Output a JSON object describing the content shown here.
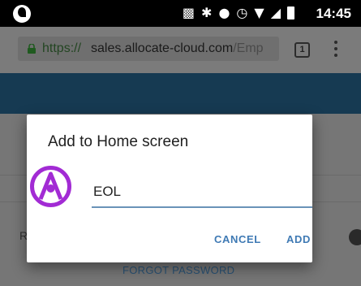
{
  "status_bar": {
    "time": "14:45"
  },
  "browser": {
    "url_scheme": "https://",
    "url_host": "sales.allocate-cloud.com",
    "url_path": "/Emp",
    "tab_count": "1"
  },
  "page": {
    "fragment_letter": "R",
    "forgot_password": "FORGOT PASSWORD"
  },
  "dialog": {
    "title": "Add to Home screen",
    "name_value": "EOL",
    "cancel_label": "CANCEL",
    "add_label": "ADD"
  },
  "colors": {
    "accent": "#3f7ab4",
    "app_icon": "#a22bd4",
    "header_band": "#163a52"
  },
  "icons": [
    "app-status-icon",
    "cast-icon",
    "bluetooth-icon",
    "do-not-disturb-icon",
    "alarm-icon",
    "wifi-icon",
    "signal-icon",
    "battery-icon",
    "lock-icon",
    "tab-switcher-icon",
    "overflow-menu-icon",
    "allocate-app-icon"
  ]
}
